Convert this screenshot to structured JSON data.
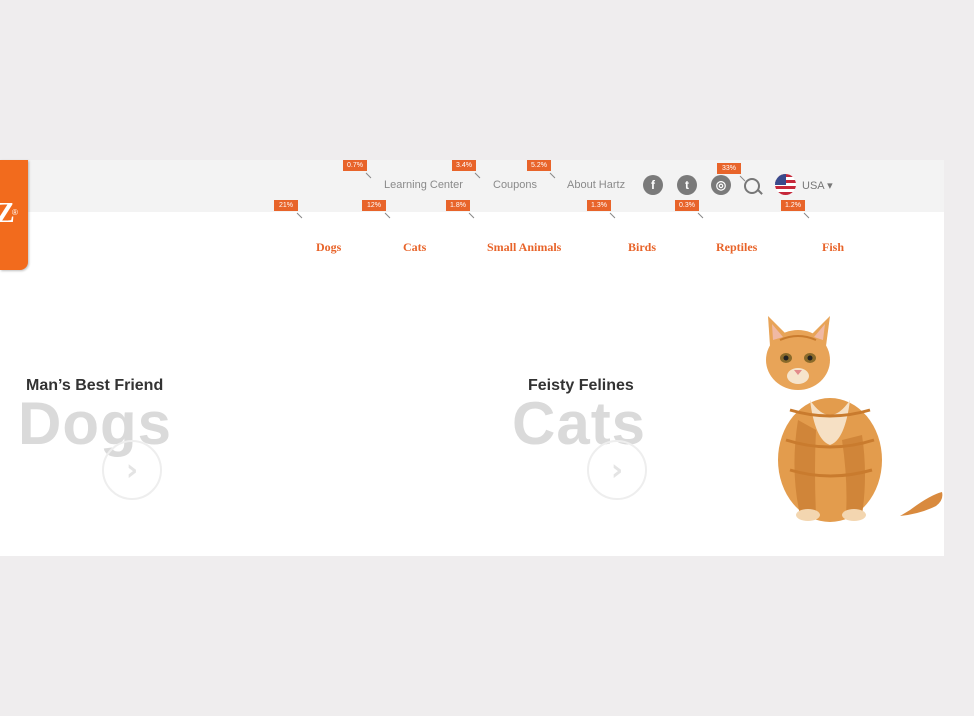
{
  "logo": {
    "text": "Z",
    "mark": "®"
  },
  "util_nav": {
    "learning_center": "Learning Center",
    "coupons": "Coupons",
    "about": "About Hartz"
  },
  "social": {
    "facebook": "f",
    "twitter": "t",
    "instagram": "◎"
  },
  "locale": {
    "country": "USA ▾"
  },
  "main_nav": [
    "Dogs",
    "Cats",
    "Small Animals",
    "Birds",
    "Reptiles",
    "Fish"
  ],
  "badges": {
    "learning_center": "0.7%",
    "coupons": "3.4%",
    "about": "5.2%",
    "search": "33%",
    "dogs": "21%",
    "cats": "12%",
    "small_animals": "1.8%",
    "birds": "1.3%",
    "reptiles": "0.3%",
    "fish": "1.2%"
  },
  "hero": {
    "dogs_sub": "Man’s Best Friend",
    "dogs_big": "Dogs",
    "cats_sub": "Feisty Felines",
    "cats_big": "Cats",
    "arrow": "›"
  },
  "colors": {
    "accent": "#e8642a",
    "brand": "#f26b1d",
    "background": "#efedee"
  }
}
